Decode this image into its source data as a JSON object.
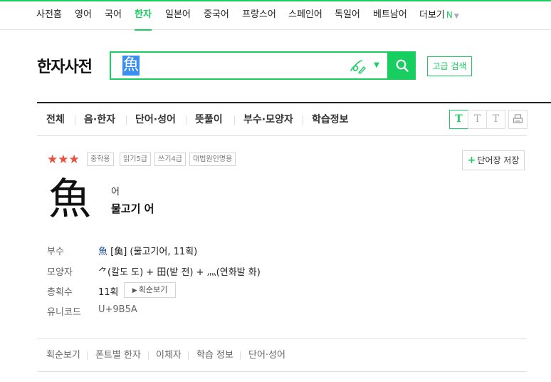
{
  "topnav": {
    "items": [
      {
        "label": "사전홈"
      },
      {
        "label": "영어"
      },
      {
        "label": "국어"
      },
      {
        "label": "한자",
        "active": true
      },
      {
        "label": "일본어"
      },
      {
        "label": "중국어"
      },
      {
        "label": "프랑스어"
      },
      {
        "label": "스페인어"
      },
      {
        "label": "독일어"
      },
      {
        "label": "베트남어"
      },
      {
        "label": "더보기"
      }
    ],
    "more_badge": "N"
  },
  "header": {
    "title": "한자사전",
    "search_value": "魚",
    "advanced_search_label": "고급 검색"
  },
  "tabs": [
    "전체",
    "음·한자",
    "단어·성어",
    "뜻풀이",
    "부수·모양자",
    "학습정보"
  ],
  "font_size_buttons": [
    "T",
    "T",
    "T"
  ],
  "entry": {
    "stars": "★★★",
    "badges": [
      "중학용",
      "읽기5급",
      "쓰기4급",
      "대법원인명용"
    ],
    "save_label": "단어장 저장",
    "character": "魚",
    "reading": "어",
    "meaning": "물고기 어",
    "info": {
      "radical_label": "부수",
      "radical_hanja": "魚",
      "radical_value": " [𩵋] (물고기어, 11획)",
      "shape_label": "모양자",
      "shape_value": "⺈(칼도 도) + 田(밭 전) + 灬(연화발 화)",
      "strokes_label": "총획수",
      "strokes_value": "11획",
      "stroke_order_label": "획순보기",
      "unicode_label": "유니코드",
      "unicode_value": "U+9B5A"
    }
  },
  "bottom_tabs": [
    "획순보기",
    "폰트별 한자",
    "이체자",
    "학습 정보",
    "단어·성어"
  ],
  "colors": {
    "accent": "#19ce60",
    "stars": "#e8513e",
    "link_hanja": "#1f4ea1"
  }
}
